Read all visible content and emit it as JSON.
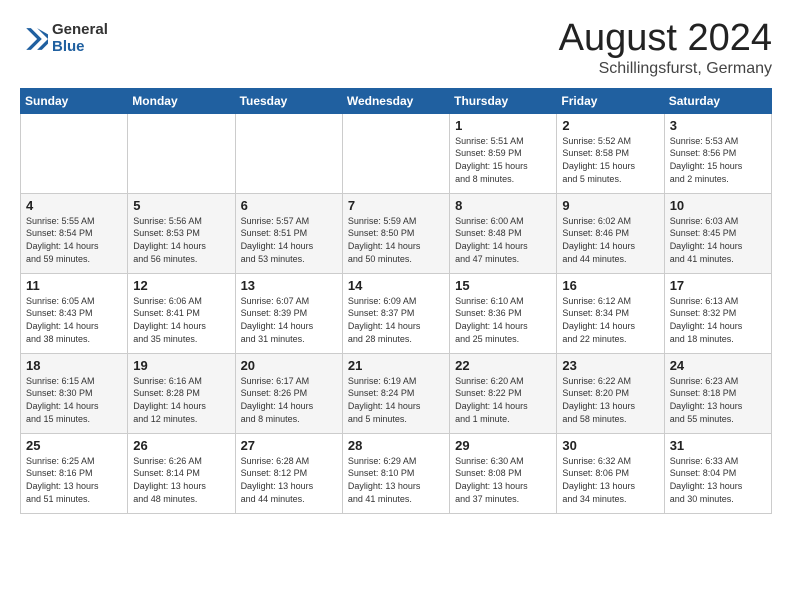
{
  "header": {
    "logo": {
      "general": "General",
      "blue": "Blue"
    },
    "title": "August 2024",
    "location": "Schillingsfurst, Germany"
  },
  "calendar": {
    "weekdays": [
      "Sunday",
      "Monday",
      "Tuesday",
      "Wednesday",
      "Thursday",
      "Friday",
      "Saturday"
    ],
    "weeks": [
      [
        {
          "day": "",
          "info": ""
        },
        {
          "day": "",
          "info": ""
        },
        {
          "day": "",
          "info": ""
        },
        {
          "day": "",
          "info": ""
        },
        {
          "day": "1",
          "info": "Sunrise: 5:51 AM\nSunset: 8:59 PM\nDaylight: 15 hours\nand 8 minutes."
        },
        {
          "day": "2",
          "info": "Sunrise: 5:52 AM\nSunset: 8:58 PM\nDaylight: 15 hours\nand 5 minutes."
        },
        {
          "day": "3",
          "info": "Sunrise: 5:53 AM\nSunset: 8:56 PM\nDaylight: 15 hours\nand 2 minutes."
        }
      ],
      [
        {
          "day": "4",
          "info": "Sunrise: 5:55 AM\nSunset: 8:54 PM\nDaylight: 14 hours\nand 59 minutes."
        },
        {
          "day": "5",
          "info": "Sunrise: 5:56 AM\nSunset: 8:53 PM\nDaylight: 14 hours\nand 56 minutes."
        },
        {
          "day": "6",
          "info": "Sunrise: 5:57 AM\nSunset: 8:51 PM\nDaylight: 14 hours\nand 53 minutes."
        },
        {
          "day": "7",
          "info": "Sunrise: 5:59 AM\nSunset: 8:50 PM\nDaylight: 14 hours\nand 50 minutes."
        },
        {
          "day": "8",
          "info": "Sunrise: 6:00 AM\nSunset: 8:48 PM\nDaylight: 14 hours\nand 47 minutes."
        },
        {
          "day": "9",
          "info": "Sunrise: 6:02 AM\nSunset: 8:46 PM\nDaylight: 14 hours\nand 44 minutes."
        },
        {
          "day": "10",
          "info": "Sunrise: 6:03 AM\nSunset: 8:45 PM\nDaylight: 14 hours\nand 41 minutes."
        }
      ],
      [
        {
          "day": "11",
          "info": "Sunrise: 6:05 AM\nSunset: 8:43 PM\nDaylight: 14 hours\nand 38 minutes."
        },
        {
          "day": "12",
          "info": "Sunrise: 6:06 AM\nSunset: 8:41 PM\nDaylight: 14 hours\nand 35 minutes."
        },
        {
          "day": "13",
          "info": "Sunrise: 6:07 AM\nSunset: 8:39 PM\nDaylight: 14 hours\nand 31 minutes."
        },
        {
          "day": "14",
          "info": "Sunrise: 6:09 AM\nSunset: 8:37 PM\nDaylight: 14 hours\nand 28 minutes."
        },
        {
          "day": "15",
          "info": "Sunrise: 6:10 AM\nSunset: 8:36 PM\nDaylight: 14 hours\nand 25 minutes."
        },
        {
          "day": "16",
          "info": "Sunrise: 6:12 AM\nSunset: 8:34 PM\nDaylight: 14 hours\nand 22 minutes."
        },
        {
          "day": "17",
          "info": "Sunrise: 6:13 AM\nSunset: 8:32 PM\nDaylight: 14 hours\nand 18 minutes."
        }
      ],
      [
        {
          "day": "18",
          "info": "Sunrise: 6:15 AM\nSunset: 8:30 PM\nDaylight: 14 hours\nand 15 minutes."
        },
        {
          "day": "19",
          "info": "Sunrise: 6:16 AM\nSunset: 8:28 PM\nDaylight: 14 hours\nand 12 minutes."
        },
        {
          "day": "20",
          "info": "Sunrise: 6:17 AM\nSunset: 8:26 PM\nDaylight: 14 hours\nand 8 minutes."
        },
        {
          "day": "21",
          "info": "Sunrise: 6:19 AM\nSunset: 8:24 PM\nDaylight: 14 hours\nand 5 minutes."
        },
        {
          "day": "22",
          "info": "Sunrise: 6:20 AM\nSunset: 8:22 PM\nDaylight: 14 hours\nand 1 minute."
        },
        {
          "day": "23",
          "info": "Sunrise: 6:22 AM\nSunset: 8:20 PM\nDaylight: 13 hours\nand 58 minutes."
        },
        {
          "day": "24",
          "info": "Sunrise: 6:23 AM\nSunset: 8:18 PM\nDaylight: 13 hours\nand 55 minutes."
        }
      ],
      [
        {
          "day": "25",
          "info": "Sunrise: 6:25 AM\nSunset: 8:16 PM\nDaylight: 13 hours\nand 51 minutes."
        },
        {
          "day": "26",
          "info": "Sunrise: 6:26 AM\nSunset: 8:14 PM\nDaylight: 13 hours\nand 48 minutes."
        },
        {
          "day": "27",
          "info": "Sunrise: 6:28 AM\nSunset: 8:12 PM\nDaylight: 13 hours\nand 44 minutes."
        },
        {
          "day": "28",
          "info": "Sunrise: 6:29 AM\nSunset: 8:10 PM\nDaylight: 13 hours\nand 41 minutes."
        },
        {
          "day": "29",
          "info": "Sunrise: 6:30 AM\nSunset: 8:08 PM\nDaylight: 13 hours\nand 37 minutes."
        },
        {
          "day": "30",
          "info": "Sunrise: 6:32 AM\nSunset: 8:06 PM\nDaylight: 13 hours\nand 34 minutes."
        },
        {
          "day": "31",
          "info": "Sunrise: 6:33 AM\nSunset: 8:04 PM\nDaylight: 13 hours\nand 30 minutes."
        }
      ]
    ]
  }
}
